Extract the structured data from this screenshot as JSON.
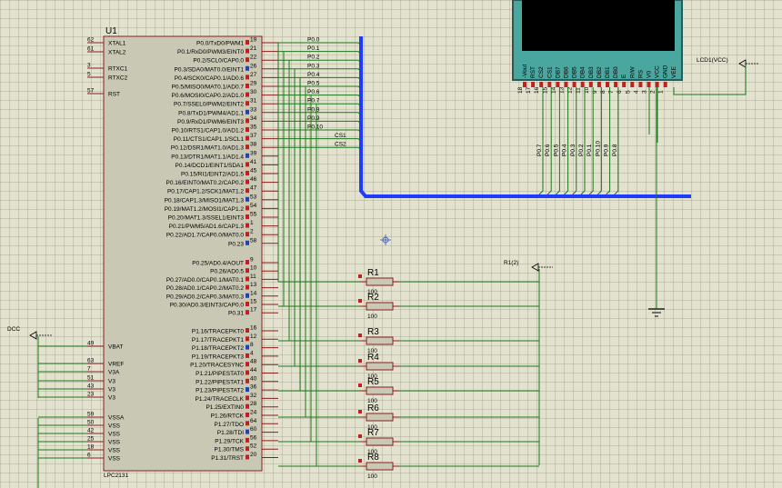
{
  "mcu": {
    "ref": "U1",
    "part": "LPC2131",
    "power_label": "DCC",
    "left_pins": [
      {
        "num": "62",
        "name": "XTAL1"
      },
      {
        "num": "61",
        "name": "XTAL2"
      },
      {
        "num": "3",
        "name": "RTXC1"
      },
      {
        "num": "5",
        "name": "RTXC2"
      },
      {
        "num": "57",
        "name": "RST"
      },
      {
        "num": "49",
        "name": "VBAT"
      },
      {
        "num": "63",
        "name": "VREF"
      },
      {
        "num": "7",
        "name": "V3A"
      },
      {
        "num": "51",
        "name": "V3"
      },
      {
        "num": "43",
        "name": "V3"
      },
      {
        "num": "23",
        "name": "V3"
      },
      {
        "num": "59",
        "name": "VSSA"
      },
      {
        "num": "50",
        "name": "VSS"
      },
      {
        "num": "42",
        "name": "VSS"
      },
      {
        "num": "25",
        "name": "VSS"
      },
      {
        "num": "18",
        "name": "VSS"
      },
      {
        "num": "6",
        "name": "VSS"
      }
    ],
    "right_pins": [
      {
        "num": "19",
        "name": "P0.0/TxD0/PWM1"
      },
      {
        "num": "21",
        "name": "P0.1/RxD0/PWM3/EINT0"
      },
      {
        "num": "22",
        "name": "P0.2/SCL0/CAP0.0"
      },
      {
        "num": "26",
        "name": "P0.3/SDA0/MAT0.0/EINT1"
      },
      {
        "num": "27",
        "name": "P0.4/SCK0/CAP0.1/AD0.6"
      },
      {
        "num": "29",
        "name": "P0.5/MISO0/MAT0.1/AD0.7"
      },
      {
        "num": "30",
        "name": "P0.6/MOSI0/CAP0.2/AD1.0"
      },
      {
        "num": "31",
        "name": "P0.7/SSEL0/PWM2/EINT2"
      },
      {
        "num": "33",
        "name": "P0.8/TxD1/PWM4/AD1.1"
      },
      {
        "num": "34",
        "name": "P0.9/RxD1/PWM6/EINT3"
      },
      {
        "num": "35",
        "name": "P0.10/RTS1/CAP1.0/AD1.2"
      },
      {
        "num": "37",
        "name": "P0.11/CTS1/CAP1.1/SCL1"
      },
      {
        "num": "38",
        "name": "P0.12/DSR1/MAT1.0/AD1.3"
      },
      {
        "num": "39",
        "name": "P0.13/DTR1/MAT1.1/AD1.4"
      },
      {
        "num": "41",
        "name": "P0.14/DCD1/EINT1/SDA1"
      },
      {
        "num": "45",
        "name": "P0.15/RI1/EINT2/AD1.5"
      },
      {
        "num": "46",
        "name": "P0.16/EINT0/MAT0.2/CAP0.2"
      },
      {
        "num": "47",
        "name": "P0.17/CAP1.2/SCK1/MAT1.2"
      },
      {
        "num": "53",
        "name": "P0.18/CAP1.3/MISO1/MAT1.3"
      },
      {
        "num": "54",
        "name": "P0.19/MAT1.2/MOSI1/CAP1.2"
      },
      {
        "num": "55",
        "name": "P0.20/MAT1.3/SSEL1/EINT3"
      },
      {
        "num": "1",
        "name": "P0.21/PWM5/AD1.6/CAP1.3"
      },
      {
        "num": "2",
        "name": "P0.22/AD1.7/CAP0.0/MAT0.0"
      },
      {
        "num": "58",
        "name": "P0.23"
      },
      {
        "num": "9",
        "name": "P0.25/AD0.4/AOUT"
      },
      {
        "num": "10",
        "name": "P0.26/AD0.5"
      },
      {
        "num": "11",
        "name": "P0.27/AD0.0/CAP0.1/MAT0.1"
      },
      {
        "num": "13",
        "name": "P0.28/AD0.1/CAP0.2/MAT0.2"
      },
      {
        "num": "14",
        "name": "P0.29/AD0.2/CAP0.3/MAT0.3"
      },
      {
        "num": "15",
        "name": "P0.30/AD0.3/EINT3/CAP0.0"
      },
      {
        "num": "17",
        "name": "P0.31"
      },
      {
        "num": "16",
        "name": "P1.16/TRACEPKT0"
      },
      {
        "num": "12",
        "name": "P1.17/TRACEPKT1"
      },
      {
        "num": "8",
        "name": "P1.18/TRACEPKT2"
      },
      {
        "num": "4",
        "name": "P1.19/TRACEPKT3"
      },
      {
        "num": "48",
        "name": "P1.20/TRACESYNC"
      },
      {
        "num": "44",
        "name": "P1.21/PIPESTAT0"
      },
      {
        "num": "40",
        "name": "P1.22/PIPESTAT1"
      },
      {
        "num": "36",
        "name": "P1.23/PIPESTAT2"
      },
      {
        "num": "32",
        "name": "P1.24/TRACECLK"
      },
      {
        "num": "28",
        "name": "P1.25/EXTIN0"
      },
      {
        "num": "24",
        "name": "P1.26/RTCK"
      },
      {
        "num": "64",
        "name": "P1.27/TDO"
      },
      {
        "num": "60",
        "name": "P1.28/TDI"
      },
      {
        "num": "56",
        "name": "P1.29/TCK"
      },
      {
        "num": "52",
        "name": "P1.30/TMS"
      },
      {
        "num": "20",
        "name": "P1.31/TRST"
      }
    ]
  },
  "bus_labels": [
    "P0.0",
    "P0.1",
    "P0.2",
    "P0.3",
    "P0.4",
    "P0.5",
    "P0.6",
    "P0.7",
    "P0.8",
    "P0.9",
    "P0.10",
    "CS1",
    "CS2"
  ],
  "lcd": {
    "power_label": "LCD1(VCC)",
    "pins": [
      "-Vout",
      "RST",
      "CS2",
      "CS1",
      "DB7",
      "DB6",
      "DB5",
      "DB4",
      "DB3",
      "DB2",
      "DB1",
      "DB0",
      "E",
      "R/W",
      "RS",
      "V0",
      "VCC",
      "GND",
      "VEE"
    ],
    "pin_numbers": [
      "18",
      "17",
      "16",
      "15",
      "14",
      "13",
      "12",
      "11",
      "10",
      "9",
      "8",
      "7",
      "6",
      "5",
      "4",
      "3",
      "2",
      "1"
    ],
    "bus_labels": [
      "P0.7",
      "P0.6",
      "P0.5",
      "P0.4",
      "P0.3",
      "P0.2",
      "P0.1",
      "P0.10",
      "P0.9",
      "P0.8"
    ]
  },
  "resistors": {
    "power_label": "R1(2)",
    "items": [
      {
        "ref": "R1",
        "value": "100"
      },
      {
        "ref": "R2",
        "value": "100"
      },
      {
        "ref": "R3",
        "value": "100"
      },
      {
        "ref": "R4",
        "value": "100"
      },
      {
        "ref": "R5",
        "value": "100"
      },
      {
        "ref": "R6",
        "value": "100"
      },
      {
        "ref": "R7",
        "value": "100"
      },
      {
        "ref": "R8",
        "value": "100"
      }
    ]
  }
}
